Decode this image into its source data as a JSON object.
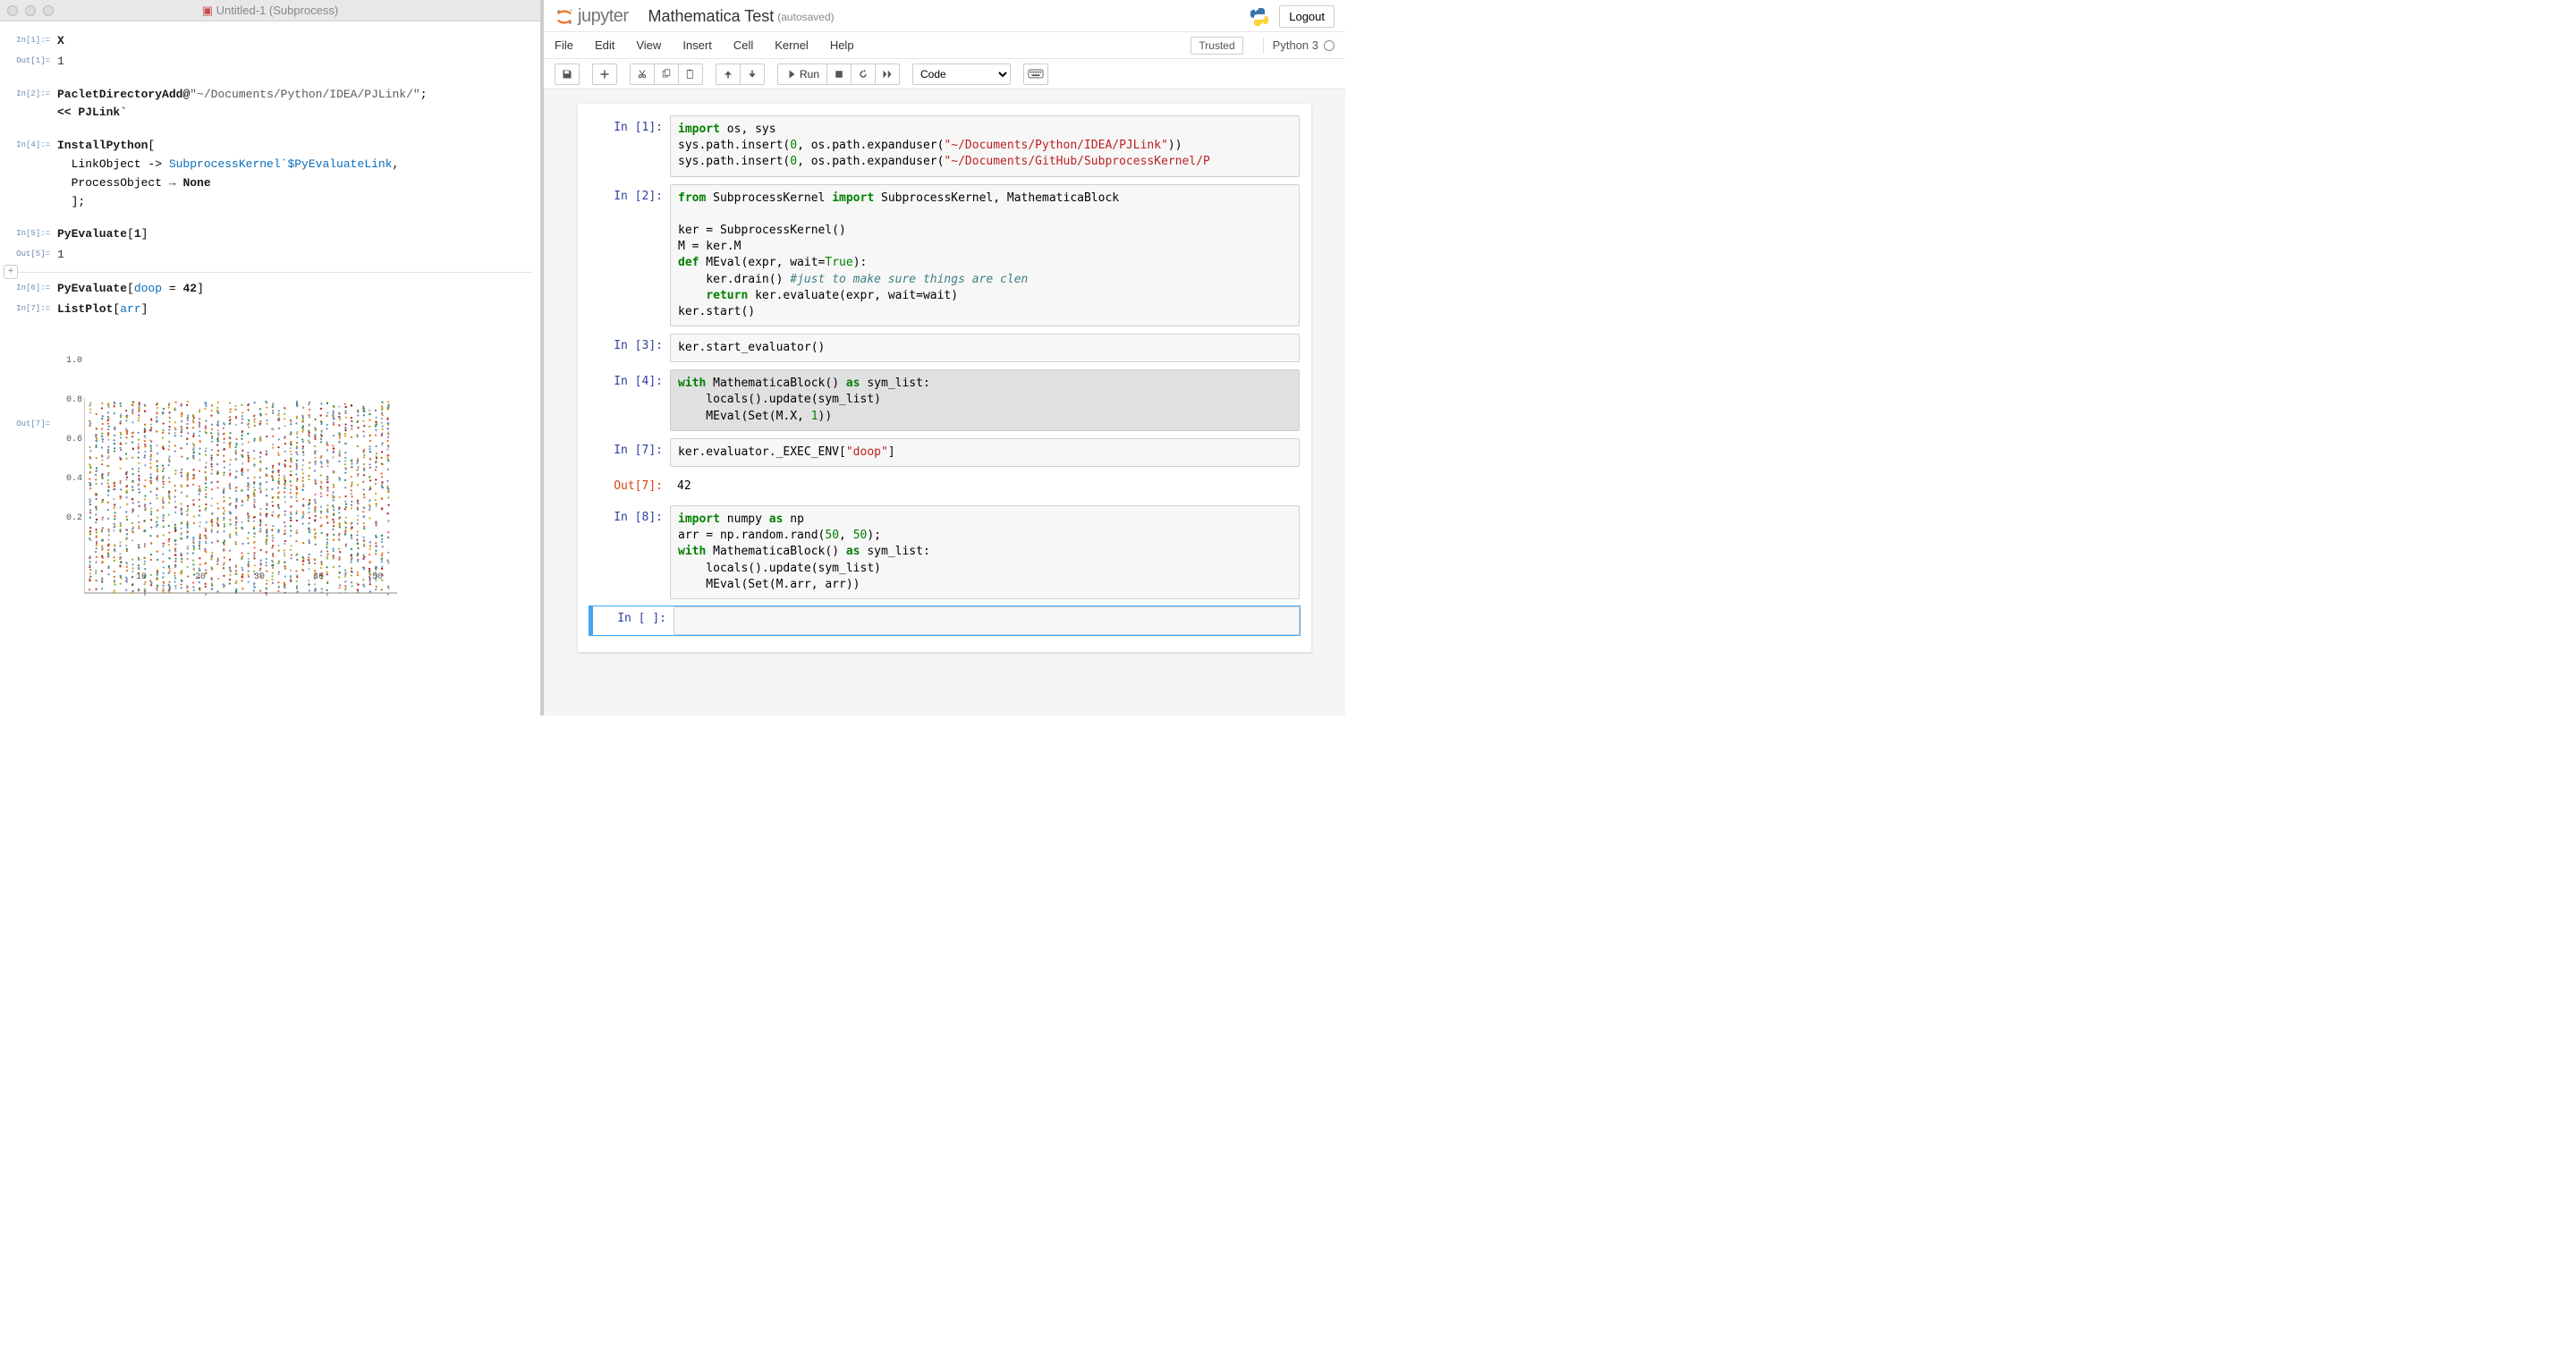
{
  "left": {
    "title": "Untitled-1 (Subprocess)",
    "cells": [
      {
        "label": "In[1]:=",
        "body_id": "m1"
      },
      {
        "label": "Out[1]=",
        "body": "1",
        "out": true
      },
      {
        "label": "",
        "gap": true
      },
      {
        "label": "In[2]:=",
        "body_id": "m2"
      },
      {
        "label": "",
        "gap": true
      },
      {
        "label": "In[4]:=",
        "body_id": "m4"
      },
      {
        "label": "",
        "gap": true
      },
      {
        "label": "In[5]:=",
        "body_id": "m5"
      },
      {
        "label": "Out[5]=",
        "body": "1",
        "out": true
      },
      {
        "divider": true
      },
      {
        "label": "In[6]:=",
        "body_id": "m6"
      },
      {
        "label": "In[7]:=",
        "body_id": "m7"
      },
      {
        "label": "Out[7]=",
        "plot": true,
        "out": true
      }
    ],
    "chart_data": {
      "type": "scatter",
      "title": "",
      "xlabel": "",
      "ylabel": "",
      "xlim": [
        0,
        50
      ],
      "ylim": [
        0,
        1.02
      ],
      "xticks": [
        10,
        20,
        30,
        40,
        50
      ],
      "yticks": [
        0.2,
        0.4,
        0.6,
        0.8,
        1.0
      ],
      "note": "50x50 random matrix plotted as overlaid column dots (values uniform in [0,1])"
    }
  },
  "jupyter": {
    "brand": "jupyter",
    "notebook_title": "Mathematica Test",
    "autosave": "(autosaved)",
    "logout": "Logout",
    "menus": [
      "File",
      "Edit",
      "View",
      "Insert",
      "Cell",
      "Kernel",
      "Help"
    ],
    "trusted": "Trusted",
    "kernel_name": "Python 3",
    "toolbar": {
      "run_label": "Run",
      "celltype": "Code"
    },
    "cells": [
      {
        "prompt": "In [1]:",
        "code_id": "jc1"
      },
      {
        "prompt": "In [2]:",
        "code_id": "jc2"
      },
      {
        "prompt": "In [3]:",
        "code_id": "jc3"
      },
      {
        "prompt": "In [4]:",
        "code_id": "jc4",
        "highlighted": true
      },
      {
        "prompt": "In [7]:",
        "code_id": "jc7"
      },
      {
        "prompt": "Out[7]:",
        "output": "42",
        "out": true
      },
      {
        "prompt": "In [8]:",
        "code_id": "jc8"
      },
      {
        "prompt": "In [ ]:",
        "code_id": "jc_empty",
        "empty": true,
        "selected": true
      }
    ],
    "code": {
      "jc1_l1_a": "import",
      "jc1_l1_b": " os, sys",
      "jc1_l2_a": "sys.path.insert(",
      "jc1_l2_b": "0",
      "jc1_l2_c": ", os.path.expanduser(",
      "jc1_l2_d": "\"~/Documents/Python/IDEA/PJLink\"",
      "jc1_l2_e": "))",
      "jc1_l3_a": "sys.path.insert(",
      "jc1_l3_b": "0",
      "jc1_l3_c": ", os.path.expanduser(",
      "jc1_l3_d": "\"~/Documents/GitHub/SubprocessKernel/P",
      "jc1_l3_e": "",
      "jc2_l1_a": "from",
      "jc2_l1_b": " SubprocessKernel ",
      "jc2_l1_c": "import",
      "jc2_l1_d": " SubprocessKernel, MathematicaBlock",
      "jc2_l3": "ker = SubprocessKernel()",
      "jc2_l4": "M = ker.M",
      "jc2_l5_a": "def",
      "jc2_l5_b": " MEval(expr, wait=",
      "jc2_l5_c": "True",
      "jc2_l5_d": "):",
      "jc2_l6_a": "    ker.drain() ",
      "jc2_l6_b": "#just to make sure things are clen",
      "jc2_l7_a": "    ",
      "jc2_l7_b": "return",
      "jc2_l7_c": " ker.evaluate(expr, wait=wait)",
      "jc2_l8": "ker.start()",
      "jc3_l1": "ker.start_evaluator()",
      "jc4_l1_a": "with",
      "jc4_l1_b": " MathematicaBlock() ",
      "jc4_l1_c": "as",
      "jc4_l1_d": " sym_list:",
      "jc4_l2": "    locals().update(sym_list)",
      "jc4_l3_a": "    MEval(Set(M.X, ",
      "jc4_l3_b": "1",
      "jc4_l3_c": "))",
      "jc7_l1_a": "ker.evaluator._EXEC_ENV[",
      "jc7_l1_b": "\"doop\"",
      "jc7_l1_c": "]",
      "jc8_l1_a": "import",
      "jc8_l1_b": " numpy ",
      "jc8_l1_c": "as",
      "jc8_l1_d": " np",
      "jc8_l2_a": "arr = np.random.rand(",
      "jc8_l2_b": "50",
      "jc8_l2_c": ", ",
      "jc8_l2_d": "50",
      "jc8_l2_e": ");",
      "jc8_l3_a": "with",
      "jc8_l3_b": " MathematicaBlock() ",
      "jc8_l3_c": "as",
      "jc8_l3_d": " sym_list:",
      "jc8_l4": "    locals().update(sym_list)",
      "jc8_l5": "    MEval(Set(M.arr, arr))"
    }
  },
  "mathematica_code": {
    "m1": "X",
    "m2_a": "PacletDirectoryAdd",
    "m2_b": "@",
    "m2_c": "\"~/Documents/Python/IDEA/PJLink/\"",
    "m2_d": ";",
    "m2_l2_a": "<<",
    "m2_l2_b": " PJLink`",
    "m4_a": "InstallPython",
    "m4_b": "[",
    "m4_l2_a": "  LinkObject -> ",
    "m4_l2_b": "SubprocessKernel`$PyEvaluateLink",
    "m4_l2_c": ",",
    "m4_l3_a": "  ProcessObject ",
    "m4_l3_arrow": "→",
    "m4_l3_b": " None",
    "m4_l4": "  ];",
    "m5_a": "PyEvaluate",
    "m5_b": "[",
    "m5_c": "1",
    "m5_d": "]",
    "m6_a": "PyEvaluate",
    "m6_b": "[",
    "m6_c": "doop",
    "m6_d": " = ",
    "m6_e": "42",
    "m6_f": "]",
    "m7_a": "ListPlot",
    "m7_b": "[",
    "m7_c": "arr",
    "m7_d": "]"
  }
}
